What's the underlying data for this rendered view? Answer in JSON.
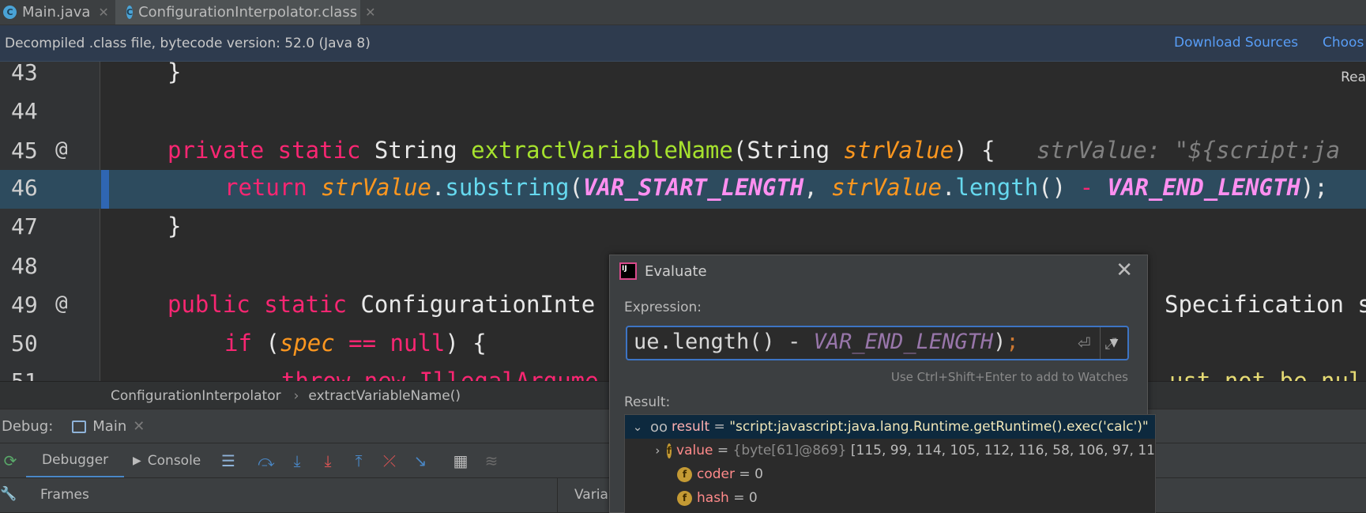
{
  "tabs": [
    {
      "label": "Main.java",
      "icon": "java-class-icon",
      "active": false
    },
    {
      "label": "ConfigurationInterpolator.class",
      "icon": "compiled-class-icon",
      "active": true
    }
  ],
  "banner": {
    "message": "Decompiled .class file, bytecode version: 52.0 (Java 8)",
    "download_sources": "Download Sources",
    "choose_sources": "Choos"
  },
  "editor": {
    "reader_mode": "Rea",
    "lines": [
      {
        "num": "43",
        "text": "}"
      },
      {
        "num": "44",
        "text": ""
      },
      {
        "num": "45",
        "at": "@",
        "kw": "private static ",
        "type": "String ",
        "fn": "extractVariableName",
        "p1": "(String ",
        "param": "strValue",
        "p2": ") {",
        "hint": "   strValue: \"${script:ja"
      },
      {
        "num": "46",
        "kw": "return ",
        "obj": "strValue",
        "dot": ".",
        "meth": "substring",
        "open": "(",
        "c1": "VAR_START_LENGTH",
        "comma": ", ",
        "obj2": "strValue",
        "dot2": ".",
        "meth2": "length",
        "mid": "() ",
        "minus": "- ",
        "c2": "VAR_END_LENGTH",
        "end": ");"
      },
      {
        "num": "47",
        "text": "}"
      },
      {
        "num": "48",
        "text": ""
      },
      {
        "num": "49",
        "at": "@",
        "kw": "public static ",
        "type": "ConfigurationInte",
        "tail": "Specification s"
      },
      {
        "num": "50",
        "kw": "if ",
        "open": "(",
        "param": "spec",
        "op": " == ",
        "kw2": "null",
        "end": ") {"
      },
      {
        "num": "51",
        "text": "throw new IllegalArgume",
        "tail": "ust not be nul"
      }
    ]
  },
  "breadcrumb": {
    "class": "ConfigurationInterpolator",
    "sep": "›",
    "method": "extractVariableName()"
  },
  "debug": {
    "label": "Debug:",
    "session": "Main",
    "tabs": [
      "Debugger",
      "Console"
    ],
    "frames_label": "Frames",
    "variables_label": "Varial"
  },
  "evaluate": {
    "title": "Evaluate",
    "expression_label": "Expression:",
    "expression_pre": "ue.length() - ",
    "expression_const": "VAR_END_LENGTH",
    "expression_paren": ")",
    "expression_semi": ";",
    "watch_hint": "Use Ctrl+Shift+Enter to add to Watches",
    "result_label": "Result:",
    "result": {
      "name": "result",
      "eq": " = ",
      "value": "\"script:javascript:java.lang.Runtime.getRuntime().exec('calc')\""
    },
    "fields": [
      {
        "name": "value",
        "eq": " = ",
        "type": "{byte[61]@869} ",
        "value": "[115, 99, 114, 105, 112, 116, 58, 106, 97, 11"
      },
      {
        "name": "coder",
        "eq": " = ",
        "value": "0"
      },
      {
        "name": "hash",
        "eq": " = ",
        "value": "0"
      }
    ]
  },
  "colors": {
    "keyword": "#f92672",
    "function": "#a6e22e",
    "param": "#fd971f",
    "constant": "#ff8ff1",
    "link": "#589df6"
  }
}
